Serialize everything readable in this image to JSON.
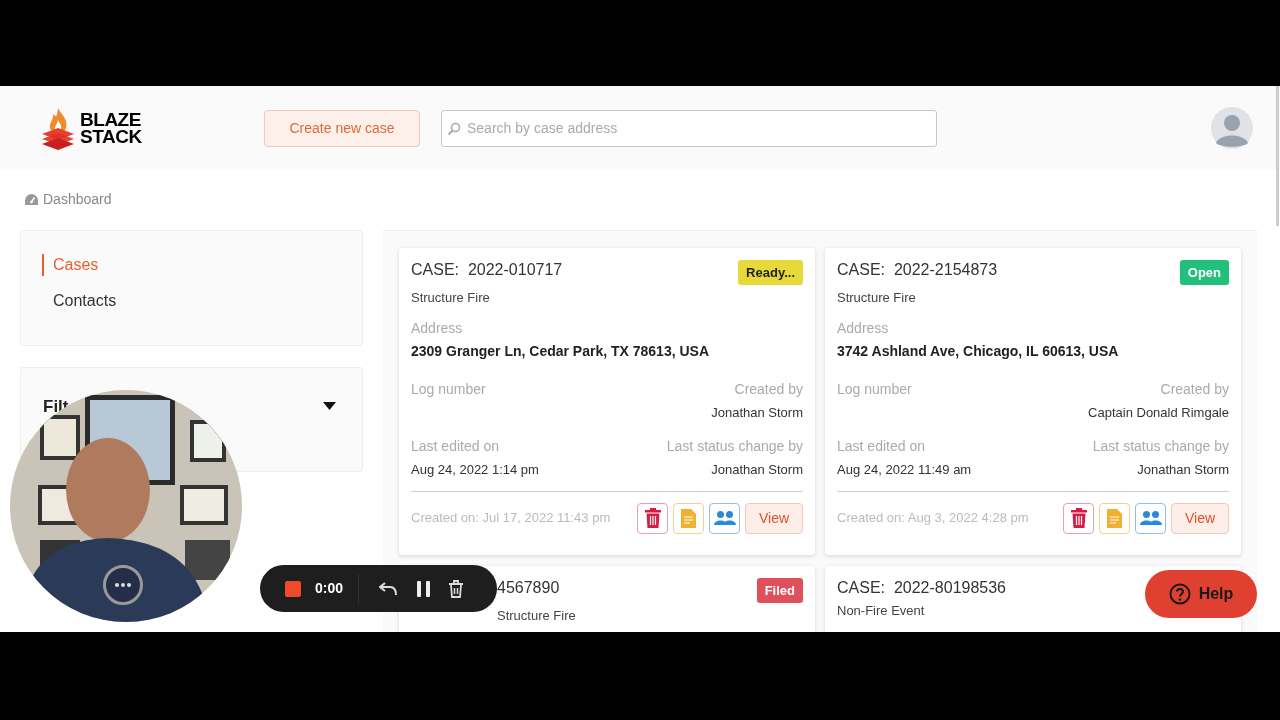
{
  "header": {
    "logo_lines": [
      "BLAZE",
      "STACK"
    ],
    "create_button": "Create new case",
    "search": {
      "placeholder": "Search by case address"
    }
  },
  "breadcrumb": "Dashboard",
  "sidebar": {
    "nav": [
      {
        "label": "Cases",
        "selected": true
      },
      {
        "label": "Contacts",
        "selected": false
      }
    ],
    "filters": {
      "title": "Filt",
      "expanded": false
    }
  },
  "cases": [
    {
      "title": "CASE:  2022-010717",
      "status": {
        "label": "Ready...",
        "color": "#e8d93a"
      },
      "type": "Structure Fire",
      "address_label": "Address",
      "address": "2309 Granger Ln, Cedar Park, TX 78613, USA",
      "log_label": "Log number",
      "created_by_label": "Created by",
      "created_by": "Jonathan Storm",
      "last_edited_label": "Last edited on",
      "last_edited": "Aug 24, 2022 1:14 pm",
      "status_change_label": "Last status change by",
      "status_change_by": "Jonathan Storm",
      "created_on": "Created on: Jul 17, 2022 11:43 pm",
      "view_button": "View"
    },
    {
      "title": "CASE:  2022-2154873",
      "status": {
        "label": "Open",
        "color": "#22c07a"
      },
      "type": "Structure Fire",
      "address_label": "Address",
      "address": "3742 Ashland Ave, Chicago, IL 60613, USA",
      "log_label": "Log number",
      "created_by_label": "Created by",
      "created_by": "Captain Donald Rimgale",
      "last_edited_label": "Last edited on",
      "last_edited": "Aug 24, 2022 11:49 am",
      "status_change_label": "Last status change by",
      "status_change_by": "Jonathan Storm",
      "created_on": "Created on: Aug 3, 2022 4:28 pm",
      "view_button": "View"
    },
    {
      "title": "4567890",
      "status": {
        "label": "Filed",
        "color": "#e0505a"
      },
      "type": "Structure Fire"
    },
    {
      "title": "CASE:  2022-80198536",
      "type": "Non-Fire Event"
    }
  ],
  "recorder": {
    "time": "0:00"
  },
  "help_button": "Help"
}
